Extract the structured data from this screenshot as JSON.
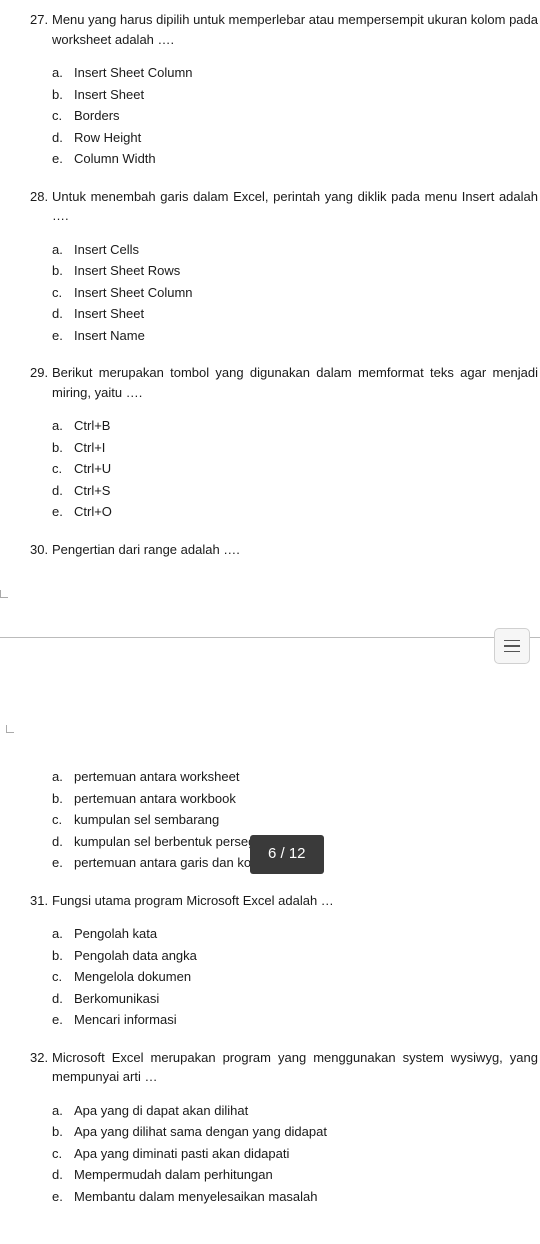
{
  "page_indicator": "6 / 12",
  "questions": [
    {
      "number": "27.",
      "text": "Menu yang harus dipilih untuk memperlebar atau mempersempit ukuran kolom pada worksheet adalah ….",
      "options": [
        {
          "letter": "a.",
          "text": "Insert Sheet Column"
        },
        {
          "letter": "b.",
          "text": "Insert Sheet"
        },
        {
          "letter": "c.",
          "text": "Borders"
        },
        {
          "letter": "d.",
          "text": "Row Height"
        },
        {
          "letter": "e.",
          "text": " Column Width"
        }
      ]
    },
    {
      "number": "28.",
      "text": "Untuk menembah garis dalam Excel, perintah yang diklik pada menu Insert adalah ….",
      "options": [
        {
          "letter": "a.",
          "text": "Insert Cells"
        },
        {
          "letter": "b.",
          "text": "Insert Sheet Rows"
        },
        {
          "letter": "c.",
          "text": "Insert Sheet Column"
        },
        {
          "letter": "d.",
          "text": "Insert Sheet"
        },
        {
          "letter": "e.",
          "text": "Insert Name"
        }
      ]
    },
    {
      "number": "29.",
      "text": "Berikut merupakan tombol yang digunakan dalam memformat teks agar menjadi miring, yaitu ….",
      "options": [
        {
          "letter": "a.",
          "text": "Ctrl+B"
        },
        {
          "letter": "b.",
          "text": "Ctrl+I"
        },
        {
          "letter": "c.",
          "text": "Ctrl+U"
        },
        {
          "letter": "d.",
          "text": "Ctrl+S"
        },
        {
          "letter": "e.",
          "text": "Ctrl+O"
        }
      ]
    },
    {
      "number": "30.",
      "text": "Pengertian dari range adalah ….",
      "options": []
    }
  ],
  "continuation_options": [
    {
      "letter": "a.",
      "text": "pertemuan antara worksheet"
    },
    {
      "letter": "b.",
      "text": "pertemuan antara workbook"
    },
    {
      "letter": "c.",
      "text": "kumpulan sel sembarang"
    },
    {
      "letter": "d.",
      "text": "kumpulan sel berbentuk persegi Panjang"
    },
    {
      "letter": "e.",
      "text": "pertemuan antara garis dan kolom"
    }
  ],
  "questions_after": [
    {
      "number": "31.",
      "text": "Fungsi utama program Microsoft Excel adalah …",
      "options": [
        {
          "letter": "a.",
          "text": "Pengolah kata"
        },
        {
          "letter": "b.",
          "text": "Pengolah data angka"
        },
        {
          "letter": "c.",
          "text": "Mengelola dokumen"
        },
        {
          "letter": "d.",
          "text": "Berkomunikasi"
        },
        {
          "letter": "e.",
          "text": "Mencari informasi"
        }
      ]
    },
    {
      "number": "32.",
      "text": "Microsoft Excel merupakan program yang menggunakan system wysiwyg, yang mempunyai arti …",
      "options": [
        {
          "letter": "a.",
          "text": "Apa yang di dapat akan dilihat"
        },
        {
          "letter": "b.",
          "text": "Apa yang dilihat sama dengan yang didapat"
        },
        {
          "letter": "c.",
          "text": "Apa yang diminati pasti akan didapati"
        },
        {
          "letter": "d.",
          "text": "Mempermudah dalam perhitungan"
        },
        {
          "letter": "e.",
          "text": "Membantu dalam menyelesaikan masalah"
        }
      ]
    }
  ]
}
